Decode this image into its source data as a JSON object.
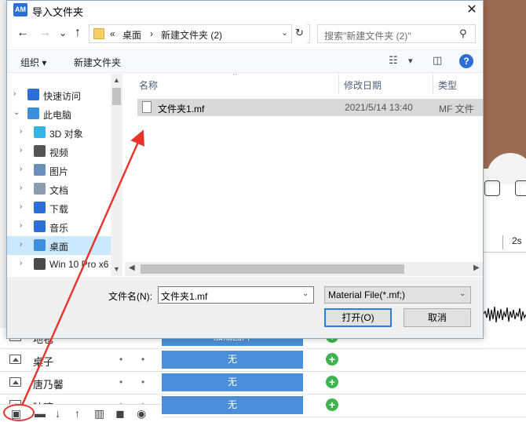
{
  "background": {
    "ruler_label": "2s",
    "rows": [
      {
        "name": "地毯",
        "bar": "加贴图片"
      },
      {
        "name": "桌子",
        "bar": "无"
      },
      {
        "name": "唐乃馨",
        "bar": "无"
      },
      {
        "name": "玻璃",
        "bar": "无"
      }
    ]
  },
  "dialog": {
    "app_badge": "AM",
    "title": "导入文件夹",
    "close": "✕",
    "nav": {
      "back": "←",
      "forward": "→",
      "recent": "⌄",
      "up": "↑"
    },
    "address": {
      "overflow": "«",
      "crumb1": "桌面",
      "sep": "›",
      "crumb2": "新建文件夹 (2)",
      "dropdown": "⌄",
      "refresh": "↻"
    },
    "search": {
      "placeholder": "搜索\"新建文件夹 (2)\"",
      "icon": "⚲"
    },
    "toolbar": {
      "organize": "组织 ▾",
      "new_folder": "新建文件夹",
      "view_icon": "☷",
      "view_dd": "▾",
      "pane_icon": "◫",
      "help": "?"
    },
    "tree": [
      {
        "label": "快速访问",
        "chev": "›",
        "icon_color": "#2b6fd6",
        "indent": 0
      },
      {
        "label": "此电脑",
        "chev": "⌄",
        "icon_color": "#3c8fde",
        "indent": 0
      },
      {
        "label": "3D 对象",
        "chev": "›",
        "icon_color": "#36b3e6",
        "indent": 1
      },
      {
        "label": "视频",
        "chev": "›",
        "icon_color": "#555555",
        "indent": 1
      },
      {
        "label": "图片",
        "chev": "›",
        "icon_color": "#6a8fb8",
        "indent": 1
      },
      {
        "label": "文档",
        "chev": "›",
        "icon_color": "#8a9cb0",
        "indent": 1
      },
      {
        "label": "下载",
        "chev": "›",
        "icon_color": "#2b6fd6",
        "indent": 1
      },
      {
        "label": "音乐",
        "chev": "›",
        "icon_color": "#2b6fd6",
        "indent": 1
      },
      {
        "label": "桌面",
        "chev": "›",
        "icon_color": "#3c8fde",
        "indent": 1,
        "selected": true
      },
      {
        "label": "Win 10 Pro x6",
        "chev": "›",
        "icon_color": "#4a4a4a",
        "indent": 1
      }
    ],
    "columns": {
      "name": "名称",
      "modified": "修改日期",
      "type": "类型",
      "sort_caret": "^"
    },
    "files": [
      {
        "name": "文件夹1.mf",
        "modified": "2021/5/14 13:40",
        "type": "MF 文件"
      }
    ],
    "filename_label": "文件名(N):",
    "filename_value": "文件夹1.mf",
    "filetype_value": "Material File(*.mf;)",
    "open_button": "打开(O)",
    "cancel_button": "取消"
  },
  "colors": {
    "annotation": "#e8322a",
    "selection": "#cce8ff",
    "accent": "#2b6fd6"
  }
}
